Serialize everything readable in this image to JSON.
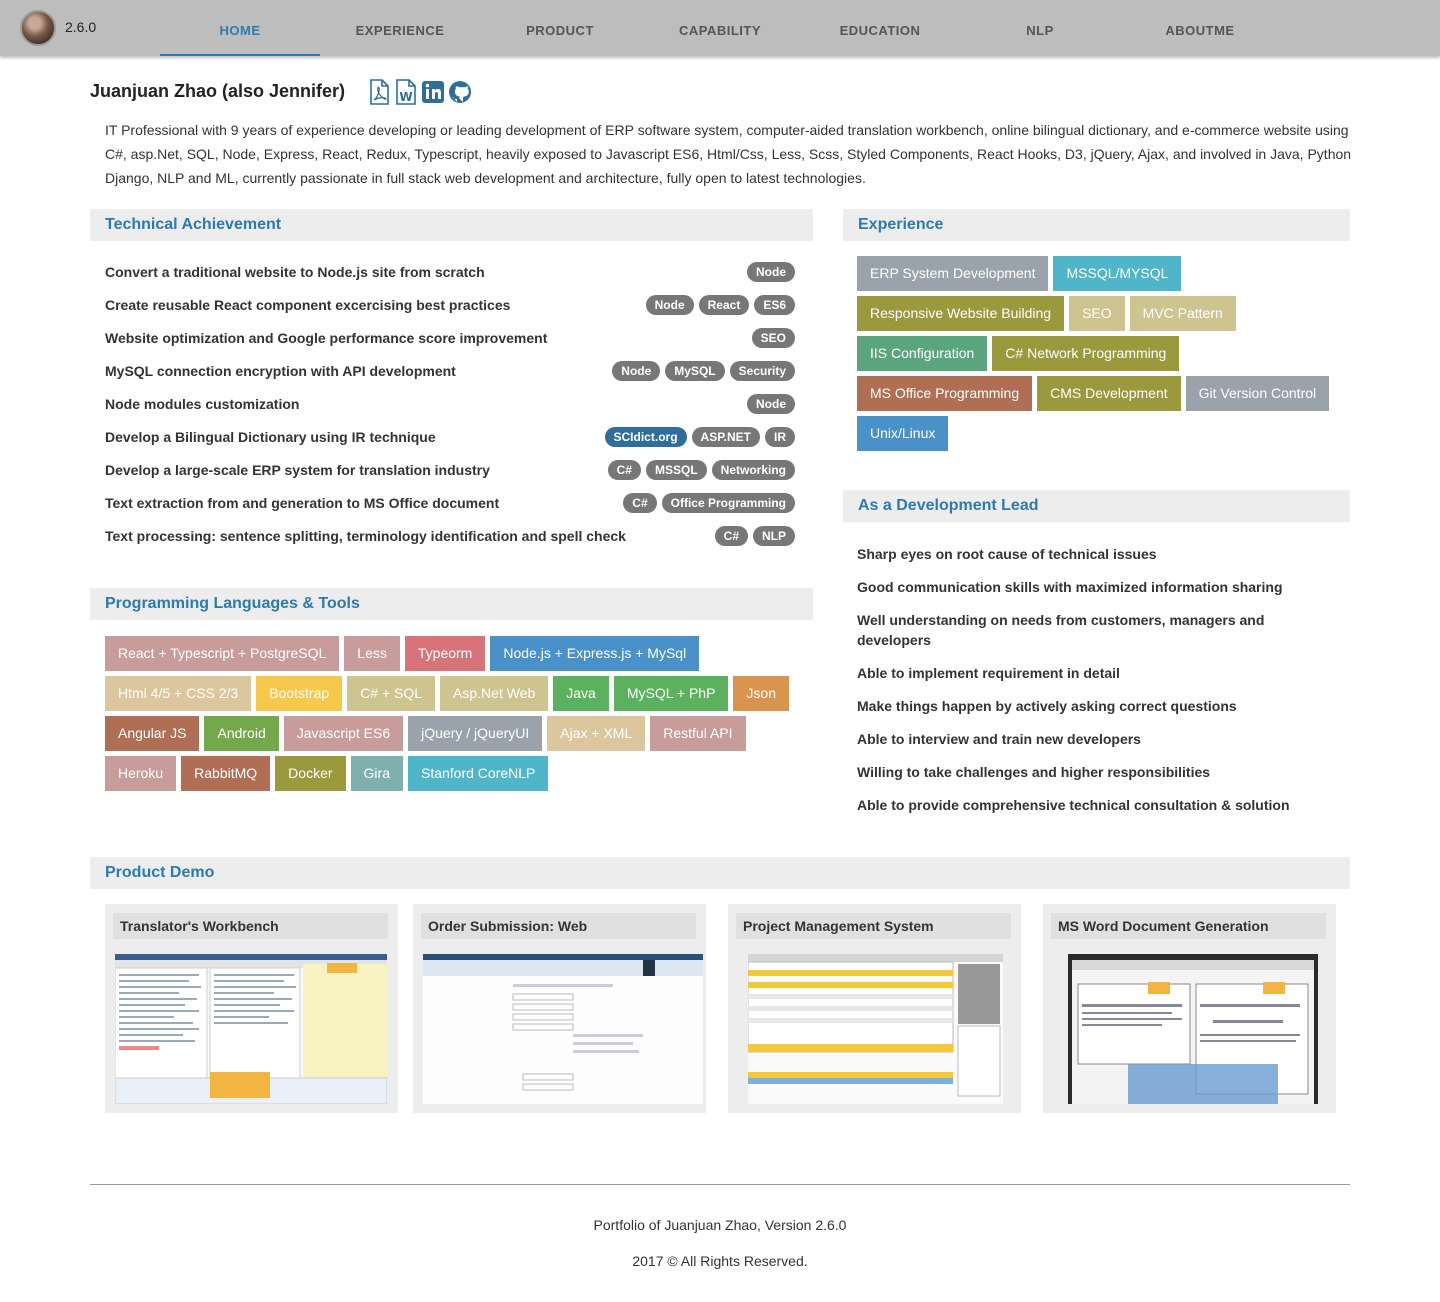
{
  "nav": {
    "version": "2.6.0",
    "items": [
      "HOME",
      "EXPERIENCE",
      "PRODUCT",
      "CAPABILITY",
      "EDUCATION",
      "NLP",
      "ABOUTME"
    ]
  },
  "header": {
    "name": "Juanjuan Zhao (also Jennifer)",
    "icons": [
      "pdf-icon",
      "word-icon",
      "linkedin-icon",
      "github-icon"
    ],
    "summary": "IT Professional with 9 years of experience developing or leading development of ERP software system, computer-aided translation workbench, online bilingual dictionary, and e-commerce website using C#, asp.Net, SQL, Node, Express, React, Redux, Typescript, heavily exposed to Javascript ES6, Html/Css, Less, Scss, Styled Components, React Hooks, D3, jQuery, Ajax, and involved in Java, Python Django, NLP and ML, currently passionate in full stack web development and architecture, fully open to latest technologies."
  },
  "technical": {
    "title": "Technical Achievement",
    "items": [
      {
        "text": "Convert a traditional website to Node.js site from scratch",
        "tags": [
          "Node"
        ]
      },
      {
        "text": "Create reusable React component excercising best practices",
        "tags": [
          "Node",
          "React",
          "ES6"
        ]
      },
      {
        "text": "Website optimization and Google performance score improvement",
        "tags": [
          "SEO"
        ]
      },
      {
        "text": "MySQL connection encryption with API development",
        "tags": [
          "Node",
          "MySQL",
          "Security"
        ]
      },
      {
        "text": "Node modules customization",
        "tags": [
          "Node"
        ]
      },
      {
        "text": "Develop a Bilingual Dictionary using IR technique",
        "tags": [
          "SCIdict.org",
          "ASP.NET",
          "IR"
        ]
      },
      {
        "text": "Develop a large-scale ERP system for translation industry",
        "tags": [
          "C#",
          "MSSQL",
          "Networking"
        ]
      },
      {
        "text": "Text extraction from and generation to MS Office document",
        "tags": [
          "C#",
          "Office Programming"
        ]
      },
      {
        "text": "Text processing: sentence splitting, terminology identification and spell check",
        "tags": [
          "C#",
          "NLP"
        ]
      }
    ]
  },
  "languages": {
    "title": "Programming Languages & Tools",
    "tags": [
      {
        "label": "React + Typescript + PostgreSQL",
        "color": "#c99c9c"
      },
      {
        "label": "Less",
        "color": "#c99c9c"
      },
      {
        "label": "Typeorm",
        "color": "#d9737a"
      },
      {
        "label": "Node.js + Express.js + MySql",
        "color": "#4a90c9"
      },
      {
        "label": "Html 4/5 + CSS 2/3",
        "color": "#dcc69e"
      },
      {
        "label": "Bootstrap",
        "color": "#f6c84c"
      },
      {
        "label": "C# + SQL",
        "color": "#cdc48f"
      },
      {
        "label": "Asp.Net Web",
        "color": "#cdc48f"
      },
      {
        "label": "Java",
        "color": "#5cb15f"
      },
      {
        "label": "MySQL + PhP",
        "color": "#5cb15f"
      },
      {
        "label": "Json",
        "color": "#d9954f"
      },
      {
        "label": "Angular JS",
        "color": "#b06e55"
      },
      {
        "label": "Android",
        "color": "#73a84b"
      },
      {
        "label": "Javascript ES6",
        "color": "#c99c9c"
      },
      {
        "label": "jQuery / jQueryUI",
        "color": "#9aa3ab"
      },
      {
        "label": "Ajax + XML",
        "color": "#dcc69e"
      },
      {
        "label": "Restful API",
        "color": "#c99c9c"
      },
      {
        "label": "Heroku",
        "color": "#c99c9c"
      },
      {
        "label": "RabbitMQ",
        "color": "#b06e55"
      },
      {
        "label": "Docker",
        "color": "#9a9a3c"
      },
      {
        "label": "Gira",
        "color": "#7fb0b0"
      },
      {
        "label": "Stanford CoreNLP",
        "color": "#4fb6c9"
      }
    ]
  },
  "experience": {
    "title": "Experience",
    "tags": [
      {
        "label": "ERP System Development",
        "color": "#9aa3ab"
      },
      {
        "label": "MSSQL/MYSQL",
        "color": "#4fb6c9"
      },
      {
        "label": "Responsive Website Building",
        "color": "#9a9a3c"
      },
      {
        "label": "SEO",
        "color": "#cdc48f"
      },
      {
        "label": "MVC Pattern",
        "color": "#cdc48f"
      },
      {
        "label": "IIS Configuration",
        "color": "#5aa57d"
      },
      {
        "label": "C# Network Programming",
        "color": "#9a9a3c"
      },
      {
        "label": "MS Office Programming",
        "color": "#b06e55"
      },
      {
        "label": "CMS Development",
        "color": "#9a9a3c"
      },
      {
        "label": "Git Version Control",
        "color": "#9aa3ab"
      },
      {
        "label": "Unix/Linux",
        "color": "#4a90c9"
      }
    ]
  },
  "lead": {
    "title": "As a Development Lead",
    "items": [
      "Sharp eyes on root cause of technical issues",
      "Good communication skills with maximized information sharing",
      "Well understanding on needs from customers, managers and developers",
      "Able to implement requirement in detail",
      "Make things happen by actively asking correct questions",
      "Able to interview and train new developers",
      "Willing to take challenges and higher responsibilities",
      "Able to provide comprehensive technical consultation & solution"
    ]
  },
  "demo": {
    "title": "Product Demo",
    "items": [
      {
        "title": "Translator's Workbench"
      },
      {
        "title": "Order Submission: Web"
      },
      {
        "title": "Project Management System"
      },
      {
        "title": "MS Word Document Generation"
      }
    ]
  },
  "footer": {
    "line1": "Portfolio of Juanjuan Zhao, Version 2.6.0",
    "line2": "2017 © All Rights Reserved."
  }
}
